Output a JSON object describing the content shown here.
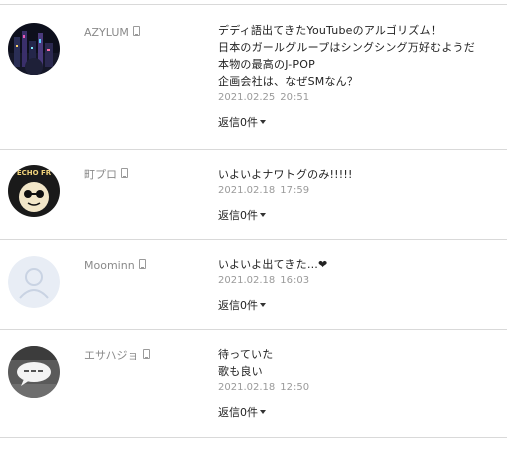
{
  "comments": [
    {
      "user": "AZYLUM",
      "avatar_icon": "city-night-avatar-icon",
      "lines": [
        "デディ語出てきたYouTubeのアルゴリズム！",
        "日本のガールグループはシングシング万好むようだ",
        "本物の最高のJ-POP",
        "企画会社は、なぜSMなん？"
      ],
      "date": "2021.02.25",
      "time": "20:51",
      "reply_label": "返信0件"
    },
    {
      "user": "町プロ",
      "avatar_icon": "afro-character-avatar-icon",
      "avatar_text": "ECHO FR",
      "lines": [
        "いよいよナワトグのみ!!!!!"
      ],
      "date": "2021.02.18",
      "time": "17:59",
      "reply_label": "返信0件"
    },
    {
      "user": "Moominn",
      "avatar_icon": "default-user-avatar-icon",
      "lines": [
        "いよいよ出てきた…❤"
      ],
      "date": "2021.02.18",
      "time": "16:03",
      "reply_label": "返信0件"
    },
    {
      "user": "エサハジョ",
      "avatar_icon": "speech-bubble-avatar-icon",
      "lines": [
        "待っていた",
        "歌も良い"
      ],
      "date": "2021.02.18",
      "time": "12:50",
      "reply_label": "返信0件"
    }
  ],
  "colors": {
    "divider": "#d9d9d9",
    "meta_gray": "#8a8a8a",
    "text": "#222222",
    "default_avatar_bg": "#e8edf5",
    "default_avatar_fg": "#c9d3e3"
  }
}
